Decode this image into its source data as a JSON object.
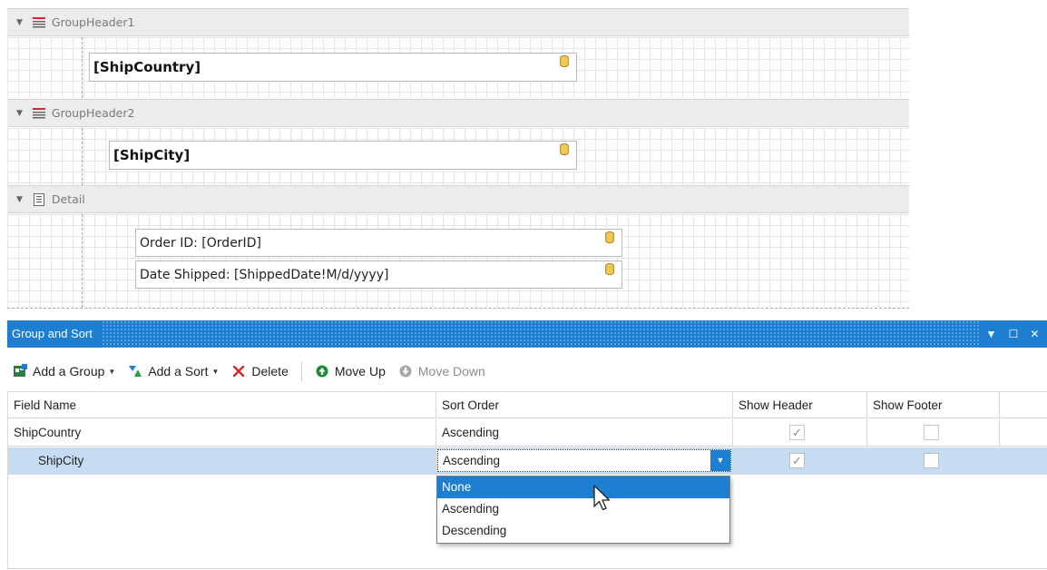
{
  "designer": {
    "bands": [
      {
        "name": "GroupHeader1",
        "field": "[ShipCountry]"
      },
      {
        "name": "GroupHeader2",
        "field": "[ShipCity]"
      },
      {
        "name": "Detail",
        "fields": [
          "Order ID: [OrderID]",
          "Date Shipped: [ShippedDate!M/d/yyyy]"
        ]
      }
    ]
  },
  "panel": {
    "title": "Group and Sort",
    "toolbar": {
      "add_group": "Add a Group",
      "add_sort": "Add a Sort",
      "delete": "Delete",
      "move_up": "Move Up",
      "move_down": "Move Down"
    },
    "columns": [
      "Field Name",
      "Sort Order",
      "Show Header",
      "Show Footer"
    ],
    "rows": [
      {
        "field": "ShipCountry",
        "sort": "Ascending",
        "show_header": true,
        "show_footer": false
      },
      {
        "field": "ShipCity",
        "sort": "Ascending",
        "show_header": true,
        "show_footer": false
      }
    ],
    "sort_options": [
      "None",
      "Ascending",
      "Descending"
    ],
    "highlighted_option": "None"
  },
  "colors": {
    "accent": "#1e7fd2",
    "selected_row": "#c6dcf3",
    "band_header": "#ececec",
    "delete_red": "#d9262a",
    "move_up_green": "#1f8a3a"
  },
  "icons": [
    "group-header-icon",
    "detail-band-icon",
    "database-icon",
    "add-group-icon",
    "add-sort-icon",
    "delete-icon",
    "move-up-icon",
    "move-down-icon",
    "pin-icon",
    "maximize-icon",
    "close-icon",
    "checkmark-icon",
    "mouse-cursor-icon"
  ]
}
